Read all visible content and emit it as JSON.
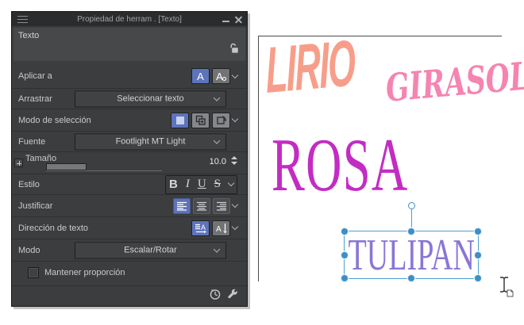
{
  "panel": {
    "title": "Propiedad de herram . [Texto]",
    "tool_name": "Texto",
    "rows": {
      "aplicar": {
        "label": "Aplicar a"
      },
      "arrastrar": {
        "label": "Arrastrar",
        "value": "Seleccionar texto"
      },
      "modo_seleccion": {
        "label": "Modo de selección"
      },
      "fuente": {
        "label": "Fuente",
        "value": "Footlight MT Light"
      },
      "tamano": {
        "label": "Tamaño",
        "value": "10.0"
      },
      "estilo": {
        "label": "Estilo",
        "bold": "B",
        "italic": "I",
        "underline": "U",
        "strike": "S"
      },
      "justificar": {
        "label": "Justificar"
      },
      "direccion": {
        "label": "Dirección de texto"
      },
      "modo": {
        "label": "Modo",
        "value": "Escalar/Rotar"
      },
      "mantener_proporcion": {
        "label": "Mantener proporción",
        "checked": false
      }
    },
    "colors": {
      "accent": "#5d74bc",
      "background": "#3b3d3f",
      "titlebar": "#2b2c2e"
    }
  },
  "icons": {
    "apply_a": "A",
    "apply_a_alt": "A",
    "dir_a": "A"
  },
  "canvas": {
    "words": [
      {
        "text": "LIRIO",
        "color": "#f79e8a"
      },
      {
        "text": "GIRASOL",
        "color": "#f584b1"
      },
      {
        "text": "ROSA",
        "color": "#c32cc3"
      },
      {
        "text": "TULIPAN",
        "color": "#8a76d6",
        "selected": true
      }
    ],
    "selection_color": "#3e8ec5"
  }
}
